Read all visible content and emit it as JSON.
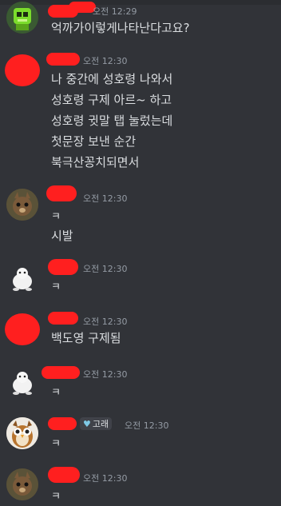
{
  "top_partial_text": "반 오 관하다는 버 ㅈ 나 타 어 지 찌어 있어 ^",
  "messages": [
    {
      "id": "m1",
      "timestamp": "오전 12:29",
      "lines": [
        "억까가이렇게나타난다고요?"
      ],
      "avatar": "green-robot-avatar"
    },
    {
      "id": "m2",
      "timestamp": "오전 12:30",
      "lines": [
        "나 중간에 성호령 나와서",
        "성호령 구제 아르~ 하고",
        "성호령 귓말 탭 눌렀는데",
        "첫문장 보낸 순간",
        "북극산꽁치되면서"
      ],
      "avatar": "redacted-avatar"
    },
    {
      "id": "m3",
      "timestamp": "오전 12:30",
      "lines": [
        "ㅋ",
        "시발"
      ],
      "avatar": "squirrel-avatar"
    },
    {
      "id": "m4",
      "timestamp": "오전 12:30",
      "lines": [
        "ㅋ"
      ],
      "avatar": "white-creature-avatar"
    },
    {
      "id": "m5",
      "timestamp": "오전 12:30",
      "lines": [
        "백도영 구제됨"
      ],
      "avatar": "redacted-avatar"
    },
    {
      "id": "m6",
      "timestamp": "오전 12:30",
      "lines": [
        "ㅋ"
      ],
      "avatar": "white-creature-avatar"
    },
    {
      "id": "m7",
      "timestamp": "오전 12:30",
      "badge": "고래",
      "lines": [
        "ㅋ"
      ],
      "avatar": "owl-avatar"
    },
    {
      "id": "m8",
      "timestamp": "오전 12:30",
      "lines": [
        "ㅋ"
      ],
      "avatar": "squirrel-avatar"
    }
  ],
  "colors": {
    "background": "#313338",
    "text": "#dbdee1",
    "muted": "#949ba4",
    "redaction": "#ff1f1f"
  }
}
